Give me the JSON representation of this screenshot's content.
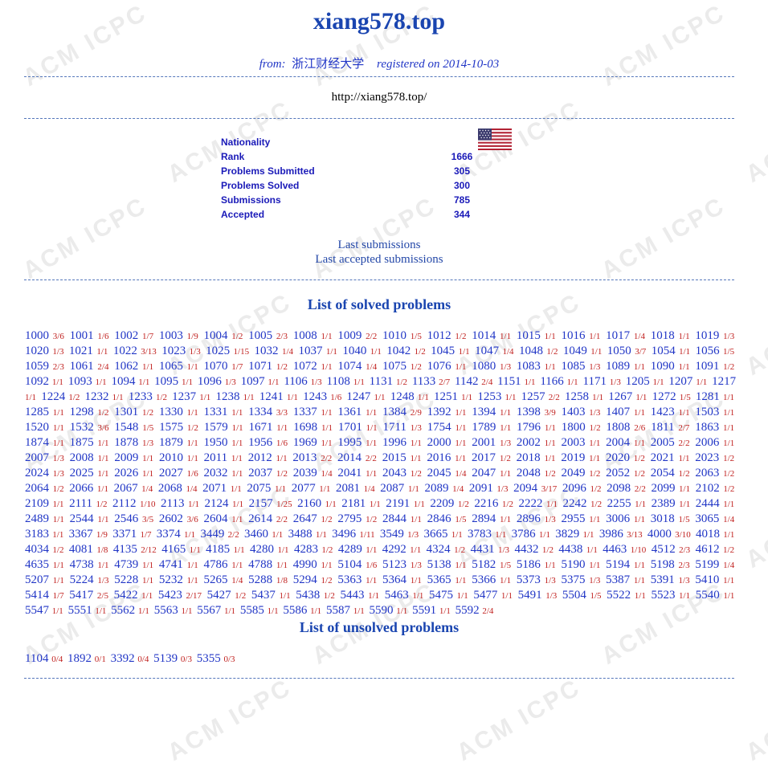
{
  "header": {
    "title": "xiang578.top",
    "from_label": "from:",
    "university": "浙江财经大学",
    "registered": "registered on 2014-10-03",
    "homepage": "http://xiang578.top/"
  },
  "stats": [
    {
      "label": "Nationality",
      "value": ""
    },
    {
      "label": "Rank",
      "value": "1666"
    },
    {
      "label": "Problems Submitted",
      "value": "305"
    },
    {
      "label": "Problems Solved",
      "value": "300"
    },
    {
      "label": "Submissions",
      "value": "785"
    },
    {
      "label": "Accepted",
      "value": "344"
    }
  ],
  "flag_icon": "usa-flag-icon",
  "links": {
    "last_submissions": "Last submissions",
    "last_accepted": "Last accepted submissions"
  },
  "solved_title": "List of solved problems",
  "unsolved_title": "List of unsolved problems",
  "watermark": "ACM ICPC",
  "colors": {
    "title": "#1a45b0",
    "problem_id": "#2136c6",
    "ratio": "#c0201e",
    "stat": "#1a1ab8"
  },
  "solved": [
    [
      "1000",
      "3/6"
    ],
    [
      "1001",
      "1/6"
    ],
    [
      "1002",
      "1/7"
    ],
    [
      "1003",
      "1/9"
    ],
    [
      "1004",
      "1/2"
    ],
    [
      "1005",
      "2/3"
    ],
    [
      "1008",
      "1/1"
    ],
    [
      "1009",
      "2/2"
    ],
    [
      "1010",
      "1/5"
    ],
    [
      "1012",
      "1/2"
    ],
    [
      "1014",
      "1/1"
    ],
    [
      "1015",
      "1/1"
    ],
    [
      "1016",
      "1/1"
    ],
    [
      "1017",
      "1/4"
    ],
    [
      "1018",
      "1/1"
    ],
    [
      "1019",
      "1/3"
    ],
    [
      "1020",
      "1/3"
    ],
    [
      "1021",
      "1/1"
    ],
    [
      "1022",
      "3/13"
    ],
    [
      "1023",
      "1/3"
    ],
    [
      "1025",
      "1/15"
    ],
    [
      "1032",
      "1/4"
    ],
    [
      "1037",
      "1/1"
    ],
    [
      "1040",
      "1/1"
    ],
    [
      "1042",
      "1/2"
    ],
    [
      "1045",
      "1/1"
    ],
    [
      "1047",
      "1/4"
    ],
    [
      "1048",
      "1/2"
    ],
    [
      "1049",
      "1/1"
    ],
    [
      "1050",
      "3/7"
    ],
    [
      "1054",
      "1/1"
    ],
    [
      "1056",
      "1/5"
    ],
    [
      "1059",
      "2/3"
    ],
    [
      "1061",
      "2/4"
    ],
    [
      "1062",
      "1/1"
    ],
    [
      "1065",
      "1/1"
    ],
    [
      "1070",
      "1/7"
    ],
    [
      "1071",
      "1/2"
    ],
    [
      "1072",
      "1/1"
    ],
    [
      "1074",
      "1/4"
    ],
    [
      "1075",
      "1/2"
    ],
    [
      "1076",
      "1/1"
    ],
    [
      "1080",
      "1/3"
    ],
    [
      "1083",
      "1/1"
    ],
    [
      "1085",
      "1/3"
    ],
    [
      "1089",
      "1/1"
    ],
    [
      "1090",
      "1/1"
    ],
    [
      "1091",
      "1/2"
    ],
    [
      "1092",
      "1/1"
    ],
    [
      "1093",
      "1/1"
    ],
    [
      "1094",
      "1/1"
    ],
    [
      "1095",
      "1/1"
    ],
    [
      "1096",
      "1/3"
    ],
    [
      "1097",
      "1/1"
    ],
    [
      "1106",
      "1/3"
    ],
    [
      "1108",
      "1/1"
    ],
    [
      "1131",
      "1/2"
    ],
    [
      "1133",
      "2/7"
    ],
    [
      "1142",
      "2/4"
    ],
    [
      "1151",
      "1/1"
    ],
    [
      "1166",
      "1/1"
    ],
    [
      "1171",
      "1/3"
    ],
    [
      "1205",
      "1/1"
    ],
    [
      "1207",
      "1/1"
    ],
    [
      "1217",
      "1/1"
    ],
    [
      "1224",
      "1/2"
    ],
    [
      "1232",
      "1/1"
    ],
    [
      "1233",
      "1/2"
    ],
    [
      "1237",
      "1/1"
    ],
    [
      "1238",
      "1/1"
    ],
    [
      "1241",
      "1/1"
    ],
    [
      "1243",
      "1/6"
    ],
    [
      "1247",
      "1/1"
    ],
    [
      "1248",
      "1/1"
    ],
    [
      "1251",
      "1/1"
    ],
    [
      "1253",
      "1/1"
    ],
    [
      "1257",
      "2/2"
    ],
    [
      "1258",
      "1/1"
    ],
    [
      "1267",
      "1/1"
    ],
    [
      "1272",
      "1/5"
    ],
    [
      "1281",
      "1/1"
    ],
    [
      "1285",
      "1/1"
    ],
    [
      "1298",
      "1/2"
    ],
    [
      "1301",
      "1/2"
    ],
    [
      "1330",
      "1/1"
    ],
    [
      "1331",
      "1/1"
    ],
    [
      "1334",
      "3/3"
    ],
    [
      "1337",
      "1/1"
    ],
    [
      "1361",
      "1/1"
    ],
    [
      "1384",
      "2/9"
    ],
    [
      "1392",
      "1/1"
    ],
    [
      "1394",
      "1/1"
    ],
    [
      "1398",
      "3/9"
    ],
    [
      "1403",
      "1/3"
    ],
    [
      "1407",
      "1/1"
    ],
    [
      "1423",
      "1/1"
    ],
    [
      "1503",
      "1/1"
    ],
    [
      "1520",
      "1/1"
    ],
    [
      "1532",
      "3/6"
    ],
    [
      "1548",
      "1/5"
    ],
    [
      "1575",
      "1/2"
    ],
    [
      "1579",
      "1/1"
    ],
    [
      "1671",
      "1/1"
    ],
    [
      "1698",
      "1/1"
    ],
    [
      "1701",
      "1/1"
    ],
    [
      "1711",
      "1/3"
    ],
    [
      "1754",
      "1/1"
    ],
    [
      "1789",
      "1/1"
    ],
    [
      "1796",
      "1/1"
    ],
    [
      "1800",
      "1/2"
    ],
    [
      "1808",
      "2/6"
    ],
    [
      "1811",
      "2/7"
    ],
    [
      "1863",
      "1/1"
    ],
    [
      "1874",
      "1/1"
    ],
    [
      "1875",
      "1/1"
    ],
    [
      "1878",
      "1/3"
    ],
    [
      "1879",
      "1/1"
    ],
    [
      "1950",
      "1/1"
    ],
    [
      "1956",
      "1/6"
    ],
    [
      "1969",
      "1/1"
    ],
    [
      "1995",
      "1/1"
    ],
    [
      "1996",
      "1/1"
    ],
    [
      "2000",
      "1/1"
    ],
    [
      "2001",
      "1/3"
    ],
    [
      "2002",
      "1/1"
    ],
    [
      "2003",
      "1/1"
    ],
    [
      "2004",
      "1/1"
    ],
    [
      "2005",
      "2/2"
    ],
    [
      "2006",
      "1/1"
    ],
    [
      "2007",
      "1/3"
    ],
    [
      "2008",
      "1/1"
    ],
    [
      "2009",
      "1/1"
    ],
    [
      "2010",
      "1/1"
    ],
    [
      "2011",
      "1/1"
    ],
    [
      "2012",
      "1/1"
    ],
    [
      "2013",
      "2/2"
    ],
    [
      "2014",
      "2/2"
    ],
    [
      "2015",
      "1/1"
    ],
    [
      "2016",
      "1/1"
    ],
    [
      "2017",
      "1/2"
    ],
    [
      "2018",
      "1/1"
    ],
    [
      "2019",
      "1/1"
    ],
    [
      "2020",
      "1/2"
    ],
    [
      "2021",
      "1/1"
    ],
    [
      "2023",
      "1/2"
    ],
    [
      "2024",
      "1/3"
    ],
    [
      "2025",
      "1/1"
    ],
    [
      "2026",
      "1/1"
    ],
    [
      "2027",
      "1/6"
    ],
    [
      "2032",
      "1/1"
    ],
    [
      "2037",
      "1/2"
    ],
    [
      "2039",
      "1/4"
    ],
    [
      "2041",
      "1/1"
    ],
    [
      "2043",
      "1/2"
    ],
    [
      "2045",
      "1/4"
    ],
    [
      "2047",
      "1/1"
    ],
    [
      "2048",
      "1/2"
    ],
    [
      "2049",
      "1/2"
    ],
    [
      "2052",
      "1/2"
    ],
    [
      "2054",
      "1/2"
    ],
    [
      "2063",
      "1/2"
    ],
    [
      "2064",
      "1/2"
    ],
    [
      "2066",
      "1/1"
    ],
    [
      "2067",
      "1/4"
    ],
    [
      "2068",
      "1/4"
    ],
    [
      "2071",
      "1/1"
    ],
    [
      "2075",
      "1/1"
    ],
    [
      "2077",
      "1/1"
    ],
    [
      "2081",
      "1/4"
    ],
    [
      "2087",
      "1/1"
    ],
    [
      "2089",
      "1/4"
    ],
    [
      "2091",
      "1/3"
    ],
    [
      "2094",
      "3/17"
    ],
    [
      "2096",
      "1/2"
    ],
    [
      "2098",
      "2/2"
    ],
    [
      "2099",
      "1/1"
    ],
    [
      "2102",
      "1/2"
    ],
    [
      "2109",
      "1/1"
    ],
    [
      "2111",
      "1/2"
    ],
    [
      "2112",
      "1/10"
    ],
    [
      "2113",
      "1/1"
    ],
    [
      "2124",
      "1/1"
    ],
    [
      "2157",
      "1/25"
    ],
    [
      "2160",
      "1/1"
    ],
    [
      "2181",
      "1/1"
    ],
    [
      "2191",
      "1/1"
    ],
    [
      "2209",
      "1/2"
    ],
    [
      "2216",
      "1/2"
    ],
    [
      "2222",
      "1/1"
    ],
    [
      "2242",
      "1/2"
    ],
    [
      "2255",
      "1/1"
    ],
    [
      "2389",
      "1/1"
    ],
    [
      "2444",
      "1/1"
    ],
    [
      "2489",
      "1/1"
    ],
    [
      "2544",
      "1/1"
    ],
    [
      "2546",
      "3/5"
    ],
    [
      "2602",
      "3/6"
    ],
    [
      "2604",
      "1/1"
    ],
    [
      "2614",
      "2/2"
    ],
    [
      "2647",
      "1/2"
    ],
    [
      "2795",
      "1/2"
    ],
    [
      "2844",
      "1/1"
    ],
    [
      "2846",
      "1/5"
    ],
    [
      "2894",
      "1/1"
    ],
    [
      "2896",
      "1/3"
    ],
    [
      "2955",
      "1/1"
    ],
    [
      "3006",
      "1/1"
    ],
    [
      "3018",
      "1/5"
    ],
    [
      "3065",
      "1/4"
    ],
    [
      "3183",
      "1/1"
    ],
    [
      "3367",
      "1/9"
    ],
    [
      "3371",
      "1/7"
    ],
    [
      "3374",
      "1/1"
    ],
    [
      "3449",
      "2/2"
    ],
    [
      "3460",
      "1/1"
    ],
    [
      "3488",
      "1/1"
    ],
    [
      "3496",
      "1/11"
    ],
    [
      "3549",
      "1/3"
    ],
    [
      "3665",
      "1/1"
    ],
    [
      "3783",
      "1/1"
    ],
    [
      "3786",
      "1/1"
    ],
    [
      "3829",
      "1/1"
    ],
    [
      "3986",
      "3/13"
    ],
    [
      "4000",
      "3/10"
    ],
    [
      "4018",
      "1/1"
    ],
    [
      "4034",
      "1/2"
    ],
    [
      "4081",
      "1/8"
    ],
    [
      "4135",
      "2/12"
    ],
    [
      "4165",
      "1/1"
    ],
    [
      "4185",
      "1/1"
    ],
    [
      "4280",
      "1/1"
    ],
    [
      "4283",
      "1/2"
    ],
    [
      "4289",
      "1/1"
    ],
    [
      "4292",
      "1/1"
    ],
    [
      "4324",
      "1/2"
    ],
    [
      "4431",
      "1/3"
    ],
    [
      "4432",
      "1/2"
    ],
    [
      "4438",
      "1/1"
    ],
    [
      "4463",
      "1/10"
    ],
    [
      "4512",
      "2/3"
    ],
    [
      "4612",
      "1/2"
    ],
    [
      "4635",
      "1/1"
    ],
    [
      "4738",
      "1/1"
    ],
    [
      "4739",
      "1/1"
    ],
    [
      "4741",
      "1/1"
    ],
    [
      "4786",
      "1/1"
    ],
    [
      "4788",
      "1/1"
    ],
    [
      "4990",
      "1/1"
    ],
    [
      "5104",
      "1/6"
    ],
    [
      "5123",
      "1/3"
    ],
    [
      "5138",
      "1/1"
    ],
    [
      "5182",
      "1/5"
    ],
    [
      "5186",
      "1/1"
    ],
    [
      "5190",
      "1/1"
    ],
    [
      "5194",
      "1/1"
    ],
    [
      "5198",
      "2/3"
    ],
    [
      "5199",
      "1/4"
    ],
    [
      "5207",
      "1/1"
    ],
    [
      "5224",
      "1/3"
    ],
    [
      "5228",
      "1/1"
    ],
    [
      "5232",
      "1/1"
    ],
    [
      "5265",
      "1/4"
    ],
    [
      "5288",
      "1/8"
    ],
    [
      "5294",
      "1/2"
    ],
    [
      "5363",
      "1/1"
    ],
    [
      "5364",
      "1/1"
    ],
    [
      "5365",
      "1/1"
    ],
    [
      "5366",
      "1/1"
    ],
    [
      "5373",
      "1/3"
    ],
    [
      "5375",
      "1/3"
    ],
    [
      "5387",
      "1/1"
    ],
    [
      "5391",
      "1/3"
    ],
    [
      "5410",
      "1/1"
    ],
    [
      "5414",
      "1/7"
    ],
    [
      "5417",
      "2/5"
    ],
    [
      "5422",
      "1/1"
    ],
    [
      "5423",
      "2/17"
    ],
    [
      "5427",
      "1/2"
    ],
    [
      "5437",
      "1/1"
    ],
    [
      "5438",
      "1/2"
    ],
    [
      "5443",
      "1/1"
    ],
    [
      "5463",
      "1/1"
    ],
    [
      "5475",
      "1/1"
    ],
    [
      "5477",
      "1/1"
    ],
    [
      "5491",
      "1/3"
    ],
    [
      "5504",
      "1/5"
    ],
    [
      "5522",
      "1/1"
    ],
    [
      "5523",
      "1/1"
    ],
    [
      "5540",
      "1/1"
    ],
    [
      "5547",
      "1/1"
    ],
    [
      "5551",
      "1/1"
    ],
    [
      "5562",
      "1/1"
    ],
    [
      "5563",
      "1/1"
    ],
    [
      "5567",
      "1/1"
    ],
    [
      "5585",
      "1/1"
    ],
    [
      "5586",
      "1/1"
    ],
    [
      "5587",
      "1/1"
    ],
    [
      "5590",
      "1/1"
    ],
    [
      "5591",
      "1/1"
    ],
    [
      "5592",
      "2/4"
    ]
  ],
  "unsolved": [
    [
      "1104",
      "0/4"
    ],
    [
      "1892",
      "0/1"
    ],
    [
      "3392",
      "0/4"
    ],
    [
      "5139",
      "0/3"
    ],
    [
      "5355",
      "0/3"
    ]
  ]
}
